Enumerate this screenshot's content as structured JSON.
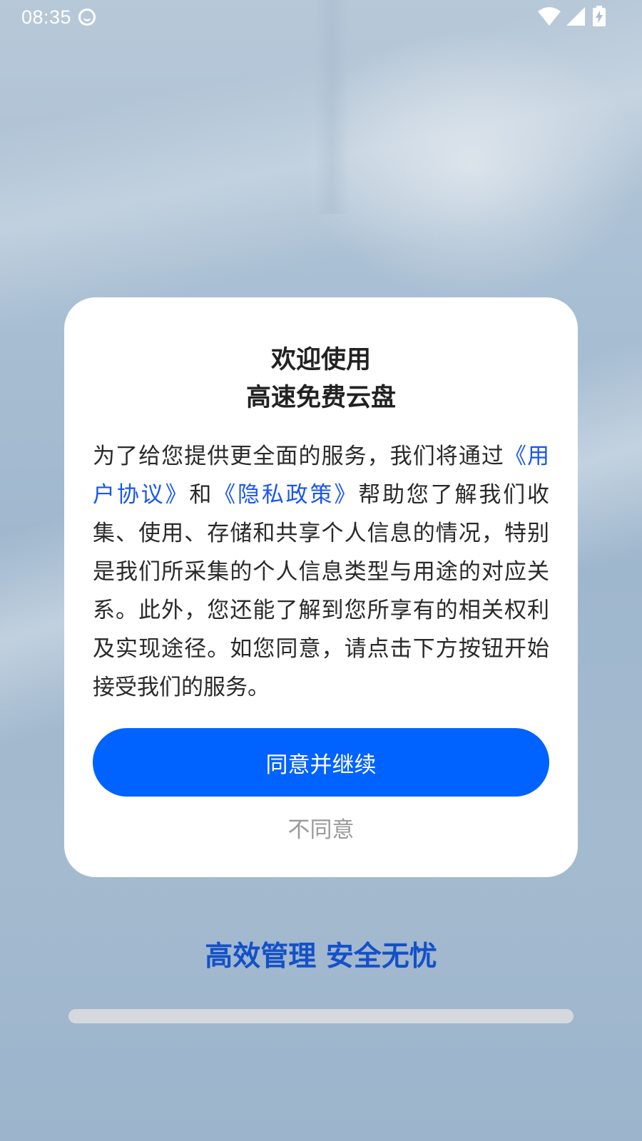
{
  "status_bar": {
    "time": "08:35",
    "icons": [
      "notification-icon",
      "wifi-icon",
      "signal-icon",
      "battery-charging-icon"
    ]
  },
  "dialog": {
    "title_line1": "欢迎使用",
    "title_line2": "高速免费云盘",
    "body_part1": "为了给您提供更全面的服务，我们将通过",
    "user_agreement_link": "《用户协议》",
    "body_and": "和",
    "privacy_policy_link": "《隐私政策》",
    "body_part2": "帮助您了解我们收集、使用、存储和共享个人信息的情况，特别是我们所采集的个人信息类型与用途的对应关系。此外，您还能了解到您所享有的相关权利及实现途径。如您同意，请点击下方按钮开始接受我们的服务。",
    "agree_label": "同意并继续",
    "disagree_label": "不同意"
  },
  "slogan": "高效管理 安全无忧",
  "colors": {
    "primary_button": "#0062ff",
    "link": "#1a56f0",
    "slogan": "#1450c8"
  }
}
